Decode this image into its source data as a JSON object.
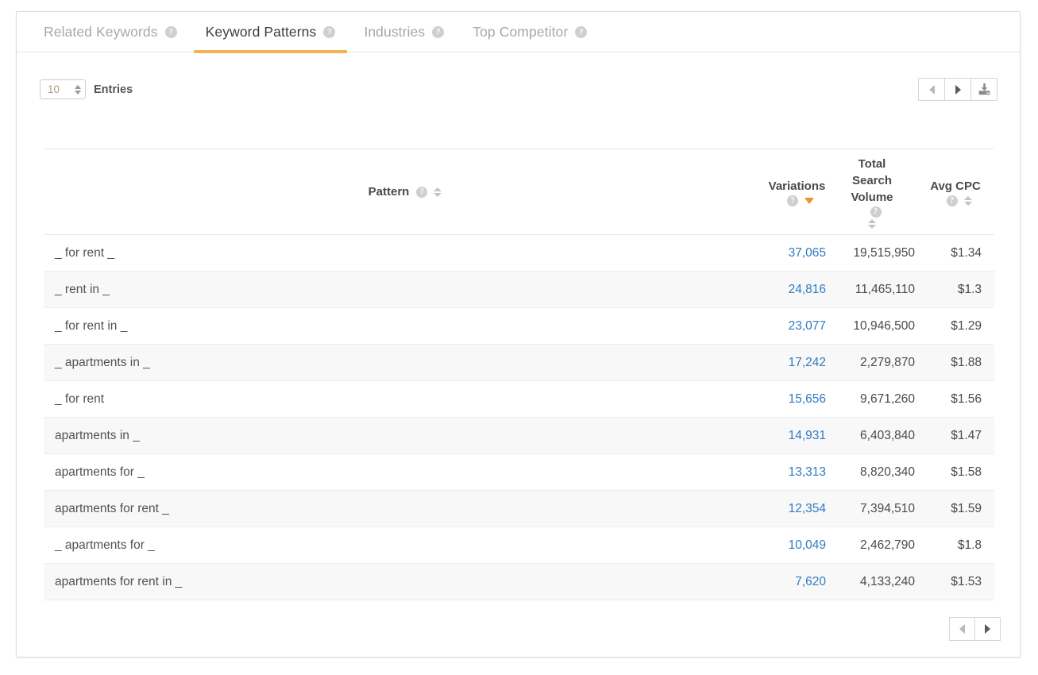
{
  "tabs": [
    {
      "label": "Related Keywords",
      "active": false,
      "help": "?"
    },
    {
      "label": "Keyword Patterns",
      "active": true,
      "help": "?"
    },
    {
      "label": "Industries",
      "active": false,
      "help": "?"
    },
    {
      "label": "Top Competitor",
      "active": false,
      "help": "?"
    }
  ],
  "toolbar": {
    "entries_value": "10",
    "entries_label": "Entries",
    "prev_icon": "triangle-left-icon",
    "next_icon": "triangle-right-icon",
    "download_icon": "download-icon"
  },
  "table": {
    "columns": [
      {
        "key": "pattern",
        "label": "Pattern",
        "help": "?",
        "sort": "none"
      },
      {
        "key": "variations",
        "label": "Variations",
        "help": "?",
        "sort": "desc"
      },
      {
        "key": "volume",
        "label": "Total\nSearch\nVolume",
        "help": "?",
        "sort": "none"
      },
      {
        "key": "cpc",
        "label": "Avg CPC",
        "help": "?",
        "sort": "none"
      }
    ],
    "rows": [
      {
        "pattern": "_ for rent _",
        "variations": "37,065",
        "volume": "19,515,950",
        "cpc": "$1.34"
      },
      {
        "pattern": "_ rent in _",
        "variations": "24,816",
        "volume": "11,465,110",
        "cpc": "$1.3"
      },
      {
        "pattern": "_ for rent in _",
        "variations": "23,077",
        "volume": "10,946,500",
        "cpc": "$1.29"
      },
      {
        "pattern": "_ apartments in _",
        "variations": "17,242",
        "volume": "2,279,870",
        "cpc": "$1.88"
      },
      {
        "pattern": "_ for rent",
        "variations": "15,656",
        "volume": "9,671,260",
        "cpc": "$1.56"
      },
      {
        "pattern": "apartments in _",
        "variations": "14,931",
        "volume": "6,403,840",
        "cpc": "$1.47"
      },
      {
        "pattern": "apartments for _",
        "variations": "13,313",
        "volume": "8,820,340",
        "cpc": "$1.58"
      },
      {
        "pattern": "apartments for rent _",
        "variations": "12,354",
        "volume": "7,394,510",
        "cpc": "$1.59"
      },
      {
        "pattern": "_ apartments for _",
        "variations": "10,049",
        "volume": "2,462,790",
        "cpc": "$1.8"
      },
      {
        "pattern": "apartments for rent in _",
        "variations": "7,620",
        "volume": "4,133,240",
        "cpc": "$1.53"
      }
    ]
  },
  "pager": {
    "prev_icon": "triangle-left-icon",
    "next_icon": "triangle-right-icon"
  },
  "colors": {
    "accent": "#f5b44f",
    "link": "#2f7bc4",
    "sort_active": "#f0922b",
    "text": "#4a4a4a",
    "muted": "#a8a8a8"
  }
}
